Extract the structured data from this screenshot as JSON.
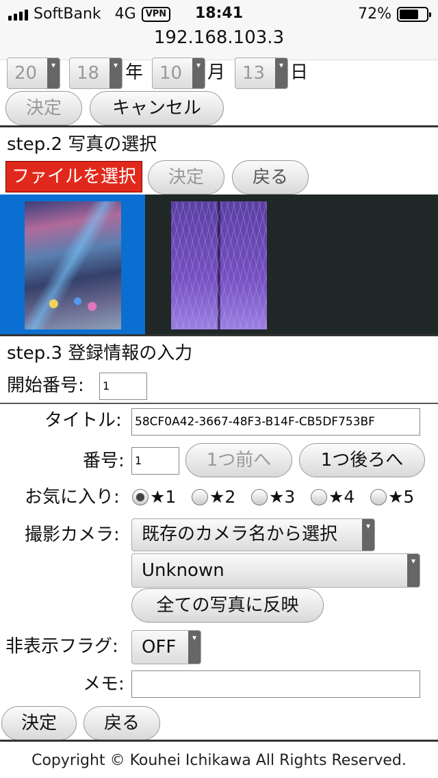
{
  "status_bar": {
    "carrier": "SoftBank",
    "network": "4G",
    "vpn": "VPN",
    "time": "18:41",
    "battery_pct": "72%",
    "battery_level": 0.72
  },
  "url": "192.168.103.3",
  "step1": {
    "date": {
      "century": "20",
      "year": "18",
      "year_unit": "年",
      "month": "10",
      "month_unit": "月",
      "day": "13",
      "day_unit": "日"
    },
    "confirm": "決定",
    "cancel": "キャンセル"
  },
  "step2": {
    "title": "step.2 写真の選択",
    "choose_file": "ファイルを選択",
    "confirm": "決定",
    "back": "戻る"
  },
  "step3": {
    "title": "step.3 登録情報の入力",
    "start_number_label": "開始番号:",
    "start_number": "1"
  },
  "form": {
    "title_label": "タイトル:",
    "title_value": "58CF0A42-3667-48F3-B14F-CB5DF753BF",
    "number_label": "番号:",
    "number_value": "1",
    "prev": "1つ前へ",
    "next": "1つ後ろへ",
    "favorite_label": "お気に入り:",
    "favorites": [
      "★1",
      "★2",
      "★3",
      "★4",
      "★5"
    ],
    "camera_label": "撮影カメラ:",
    "camera_existing": "既存のカメラ名から選択",
    "camera_value": "Unknown",
    "apply_all": "全ての写真に反映",
    "hidden_label": "非表示フラグ:",
    "hidden_value": "OFF",
    "memo_label": "メモ:",
    "memo_value": "",
    "confirm": "決定",
    "back": "戻る"
  },
  "footer": "Copyright © Kouhei Ichikawa All Rights Reserved."
}
